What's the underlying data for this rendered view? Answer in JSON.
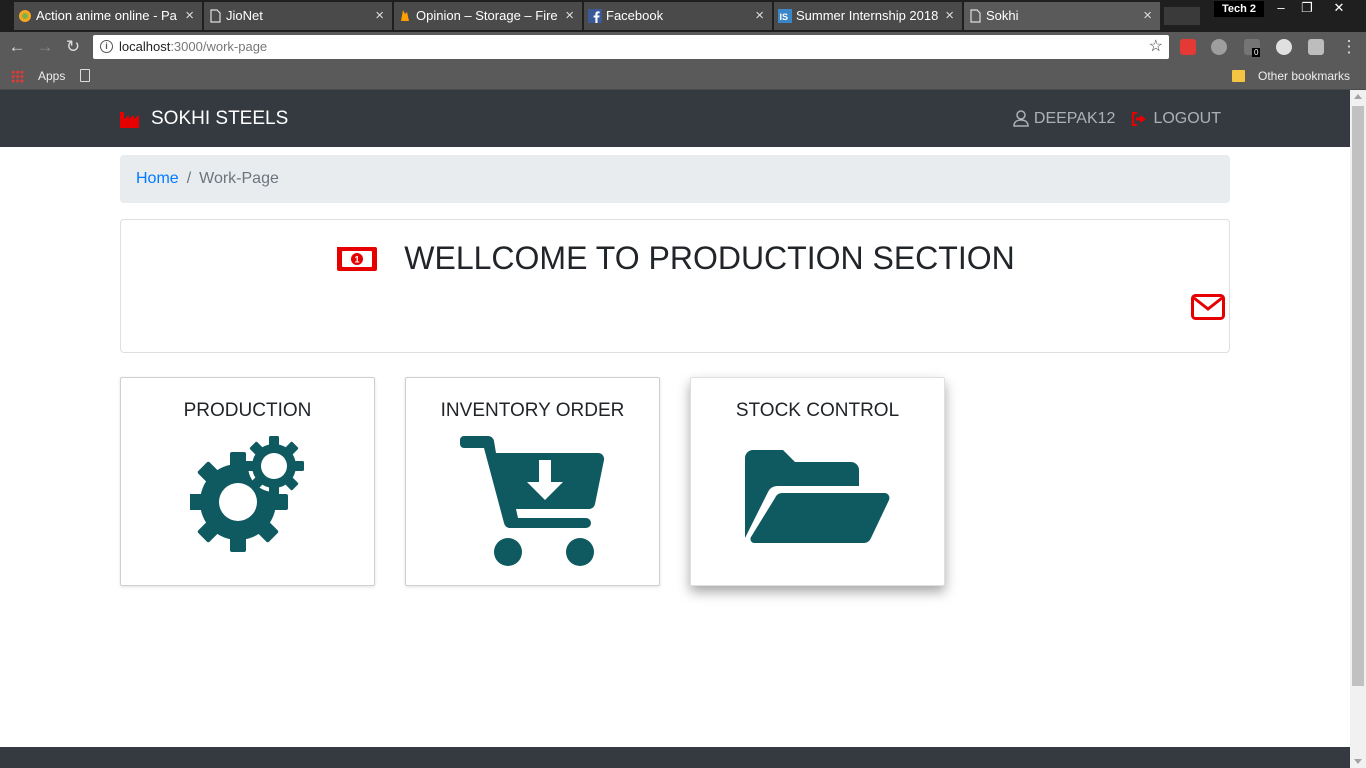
{
  "browser": {
    "tabs": [
      {
        "title": "Action anime online - Pa",
        "active": false
      },
      {
        "title": "JioNet",
        "active": false
      },
      {
        "title": "Opinion – Storage – Fireb",
        "active": false
      },
      {
        "title": "Facebook",
        "active": false
      },
      {
        "title": "Summer Internship 2018",
        "active": false
      },
      {
        "title": "Sokhi",
        "active": true
      }
    ],
    "tab_close": "×",
    "profile": "Tech 2",
    "url_host": "localhost",
    "url_path": ":3000/work-page",
    "bookmarks": {
      "apps": "Apps",
      "other": "Other bookmarks"
    },
    "extension_badge": "0"
  },
  "navbar": {
    "brand": "SOKHI STEELS",
    "user": "DEEPAK12",
    "logout": "LOGOUT"
  },
  "breadcrumb": {
    "home": "Home",
    "separator": "/",
    "current": "Work-Page"
  },
  "welcome": {
    "title": "WELLCOME TO PRODUCTION SECTION"
  },
  "cards": [
    {
      "title": "PRODUCTION",
      "icon": "gears-icon"
    },
    {
      "title": "INVENTORY ORDER",
      "icon": "cart-download-icon"
    },
    {
      "title": "STOCK CONTROL",
      "icon": "folder-open-icon"
    }
  ],
  "colors": {
    "navbar": "#343a40",
    "accent_red": "#e60000",
    "icon_teal": "#0e5a60",
    "link": "#007bff"
  }
}
